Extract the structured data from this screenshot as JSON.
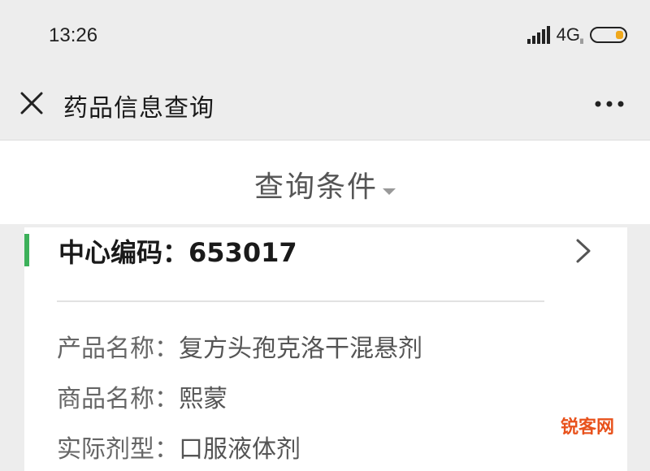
{
  "status_bar": {
    "time": "13:26",
    "network": "4G",
    "network_sub": "ll",
    "signal_icon": "signal-bars-icon",
    "battery_icon": "battery-icon",
    "battery_color": "#f0a81c"
  },
  "nav": {
    "title": "药品信息查询",
    "close_icon": "close-icon",
    "more_icon": "more-icon"
  },
  "filter": {
    "label": "查询条件",
    "icon": "caret-down-icon"
  },
  "card": {
    "accent_color": "#3cb15a",
    "code_label": "中心编码：",
    "code_value": "653017",
    "fields": [
      {
        "label": "产品名称：",
        "value": "复方头孢克洛干混悬剂"
      },
      {
        "label": "商品名称：",
        "value": "熙蒙"
      },
      {
        "label": "实际剂型：",
        "value": "口服液体剂"
      }
    ]
  },
  "watermark": {
    "text": "锐客网",
    "color": "#e8521c"
  }
}
